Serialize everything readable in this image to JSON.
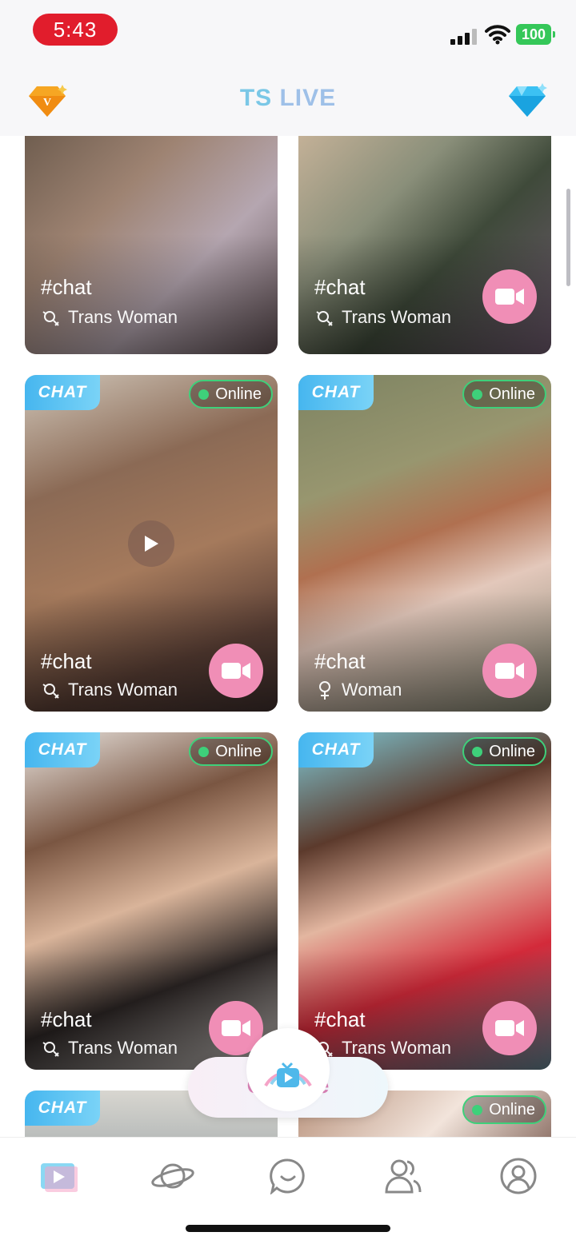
{
  "status": {
    "time": "5:43",
    "battery": "100"
  },
  "header": {
    "title_left": "TS ",
    "title_right": "LIVE"
  },
  "cards": [
    {
      "tag": "#chat",
      "gender": "Trans Woman",
      "chat_badge": "",
      "status": ""
    },
    {
      "tag": "#chat",
      "gender": "Trans Woman",
      "chat_badge": "",
      "status": ""
    },
    {
      "tag": "#chat",
      "gender": "Trans Woman",
      "chat_badge": "CHAT",
      "status": "Online"
    },
    {
      "tag": "#chat",
      "gender": "Woman",
      "chat_badge": "CHAT",
      "status": "Online"
    },
    {
      "tag": "#chat",
      "gender": "Trans Woman",
      "chat_badge": "CHAT",
      "status": "Online"
    },
    {
      "tag": "#chat",
      "gender": "Trans Woman",
      "chat_badge": "CHAT",
      "status": "Online"
    },
    {
      "tag": "",
      "gender": "",
      "chat_badge": "CHAT",
      "status": ""
    },
    {
      "tag": "",
      "gender": "",
      "chat_badge": "",
      "status": "Online"
    }
  ],
  "go_live": {
    "label": "Go Live"
  },
  "tabs": [
    "video-icon",
    "planet-icon",
    "chat-bubble-icon",
    "friends-icon",
    "profile-icon"
  ]
}
